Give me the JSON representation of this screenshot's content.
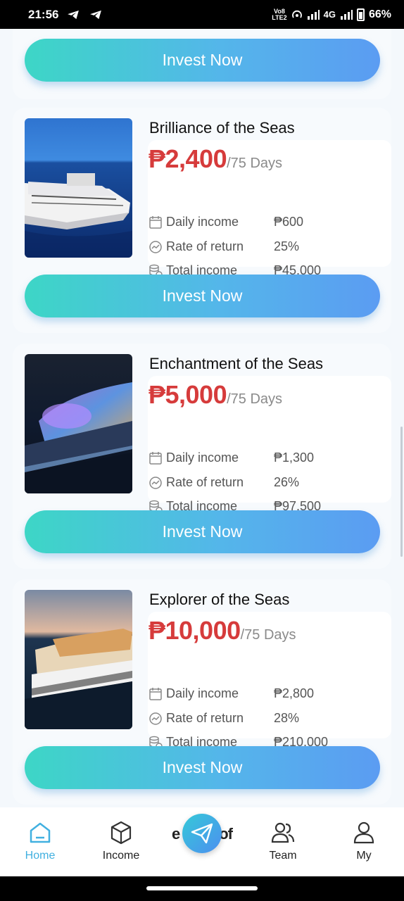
{
  "status": {
    "time": "21:56",
    "network": "4G",
    "battery": "66%",
    "volte_top": "Vo8",
    "volte_bottom": "LTE2"
  },
  "top_button_label": "Invest Now",
  "products": [
    {
      "name": "Brilliance of the Seas",
      "price": "₱2,400",
      "period": "/75 Days",
      "daily_label": "Daily income",
      "daily_value": "₱600",
      "rate_label": "Rate of return",
      "rate_value": "25%",
      "total_label": "Total income",
      "total_value": "₱45,000",
      "button_label": "Invest Now"
    },
    {
      "name": "Enchantment of the Seas",
      "price": "₱5,000",
      "period": "/75 Days",
      "daily_label": "Daily income",
      "daily_value": "₱1,300",
      "rate_label": "Rate of return",
      "rate_value": "26%",
      "total_label": "Total income",
      "total_value": "₱97,500",
      "button_label": "Invest Now"
    },
    {
      "name": "Explorer of the Seas",
      "price": "₱10,000",
      "period": "/75 Days",
      "daily_label": "Daily income",
      "daily_value": "₱2,800",
      "rate_label": "Rate of return",
      "rate_value": "28%",
      "total_label": "Total income",
      "total_value": "₱210,000",
      "button_label": "Invest Now"
    }
  ],
  "tabbar": {
    "home": "Home",
    "income": "Income",
    "team": "Team",
    "my": "My",
    "center_left": "e",
    "center_right": "of",
    "active_color": "#41b0e0"
  },
  "colors": {
    "price": "#d63b3b",
    "button_start": "#3dd6c6",
    "button_end": "#5b9cf2"
  }
}
